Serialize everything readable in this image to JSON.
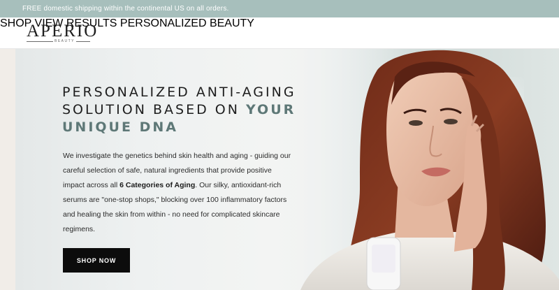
{
  "announcement": {
    "text": "FREE domestic shipping within the continental US on all orders."
  },
  "brand": {
    "name": "APERIO",
    "tagline": "BEAUTY"
  },
  "nav": {
    "items": [
      {
        "label": "SHOP"
      },
      {
        "label": "VIEW RESULTS"
      },
      {
        "label": "PERSONALIZED BEAUTY"
      }
    ]
  },
  "hero": {
    "headline_line1": "PERSONALIZED ANTI-AGING",
    "headline_line2_prefix": "SOLUTION BASED ON ",
    "headline_accent_1": "YOUR",
    "headline_accent_2": "UNIQUE DNA",
    "body_part1": "We investigate the genetics behind skin health and aging - guiding our careful selection of safe, natural ingredients that provide positive impact across all ",
    "body_bold": "6 Categories of Aging",
    "body_part2": ". Our silky, antioxidant-rich serums are \"one-stop shops,\" blocking over 100 inflammatory factors and healing the skin from within - no need for complicated skincare regimens.",
    "cta_label": "SHOP NOW",
    "image_alt": "Woman with long auburn hair in a white robe touching her face, holding a white serum bottle"
  },
  "colors": {
    "announcement_bg": "#a7bfbc",
    "accent_text": "#5e7877",
    "cta_bg": "#0c0c0c"
  }
}
